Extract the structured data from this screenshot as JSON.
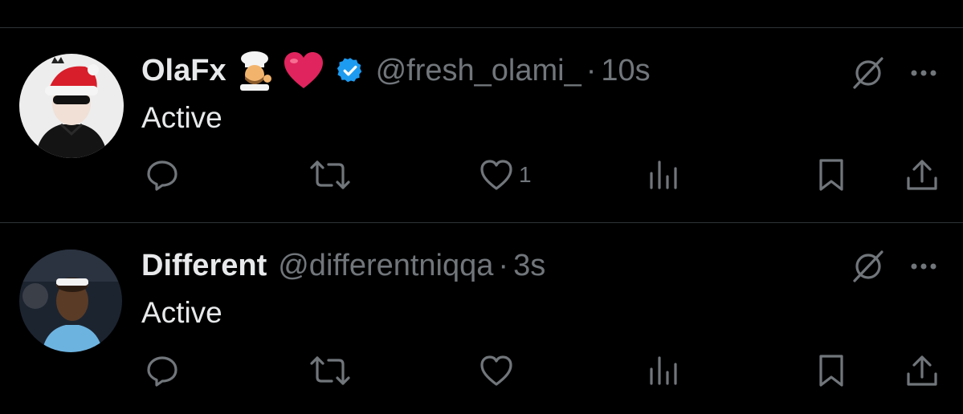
{
  "posts": [
    {
      "display_name": "OlaFx",
      "emojis": [
        "cook-emoji",
        "heart-emoji"
      ],
      "verified": true,
      "handle": "@fresh_olami_",
      "separator": "·",
      "time": "10s",
      "text": "Active",
      "likes": "1"
    },
    {
      "display_name": "Different",
      "verified": false,
      "handle": "@differentniqqa",
      "separator": "·",
      "time": "3s",
      "text": "Active",
      "likes": ""
    }
  ],
  "icons": {
    "grok": "slashed-circle-icon",
    "more": "more-dots-icon",
    "reply": "reply-bubble-icon",
    "repost": "repost-arrows-icon",
    "like": "heart-outline-icon",
    "views": "views-bars-icon",
    "bookmark": "bookmark-icon",
    "share": "share-upload-icon",
    "verified": "verified-badge-icon"
  },
  "colors": {
    "background": "#000000",
    "primary_text": "#e7e9ea",
    "secondary_text": "#71767b",
    "divider": "#2f3336",
    "verified": "#1d9bf0",
    "heart_emoji": "#e0245e"
  }
}
